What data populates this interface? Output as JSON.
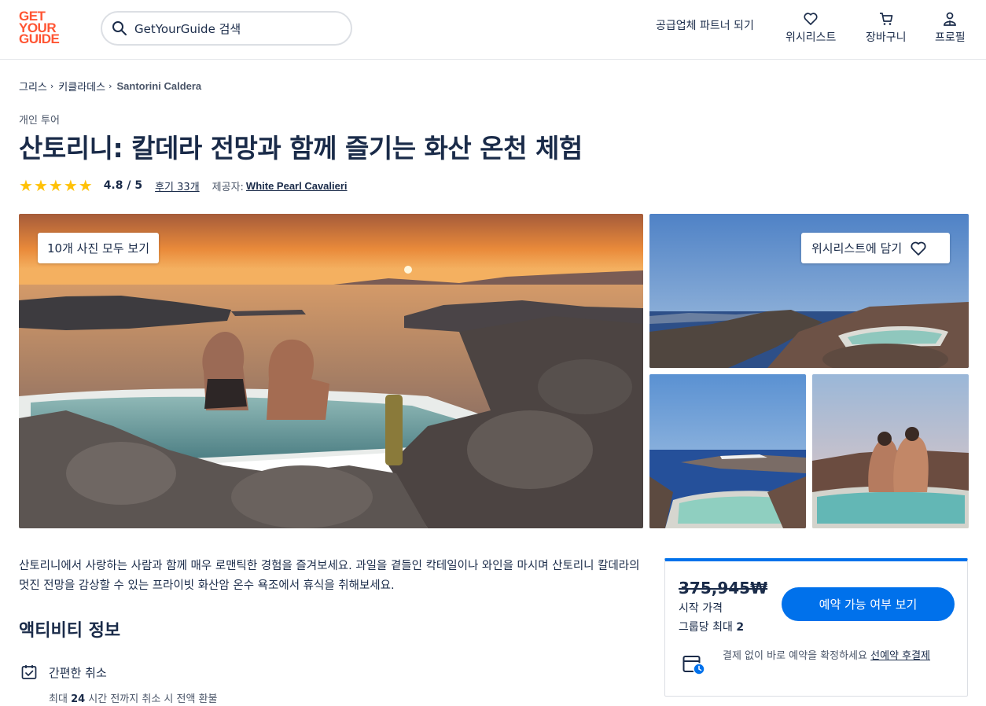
{
  "header": {
    "logo": [
      "GET",
      "YOUR",
      "GUIDE"
    ],
    "search_placeholder": "GetYourGuide 검색",
    "partner_link": "공급업체 파트너 되기",
    "nav": [
      {
        "icon": "heart-icon",
        "label": "위시리스트"
      },
      {
        "icon": "cart-icon",
        "label": "장바구니"
      },
      {
        "icon": "profile-icon",
        "label": "프로필"
      }
    ]
  },
  "breadcrumb": [
    "그리스",
    "키클라데스",
    "Santorini Caldera"
  ],
  "category": "개인 투어",
  "title": "산토리니: 칼데라 전망과 함께 즐기는 화산 온천 체험",
  "rating": {
    "stars": 5,
    "value": "4.8 / 5",
    "reviews": "후기 33개",
    "provider_label": "제공자:",
    "provider": "White Pearl Cavalieri"
  },
  "gallery": {
    "all_photos_button": "10개 사진 모두 보기",
    "wishlist_button": "위시리스트에 담기"
  },
  "description": "산토리니에서 사랑하는 사람과 함께 매우 로맨틱한 경험을 즐겨보세요. 과일을 곁들인 칵테일이나 와인을 마시며 산토리니 칼데라의 멋진 전망을 감상할 수 있는 프라이빗 화산암 온수 욕조에서 휴식을 취해보세요.",
  "activity_info": {
    "title": "액티비티 정보",
    "features": [
      {
        "icon": "calendar-check-icon",
        "title": "간편한 취소",
        "sub_prefix": "최대 ",
        "sub_bold": "24",
        "sub_suffix": " 시간 전까지 취소 시 전액 환불"
      }
    ]
  },
  "booking": {
    "price": "375,945₩",
    "price_label": "시작 가격",
    "group_label": "그룹당 최대",
    "group_max": "2",
    "button": "예약 가능 여부 보기",
    "note": "결제 없이 바로 예약을 확정하세요",
    "note_link": "선예약 후결제"
  },
  "colors": {
    "brand": "#ff5533",
    "accent": "#0071eb",
    "text": "#1a2b49",
    "star": "#ffc107"
  }
}
